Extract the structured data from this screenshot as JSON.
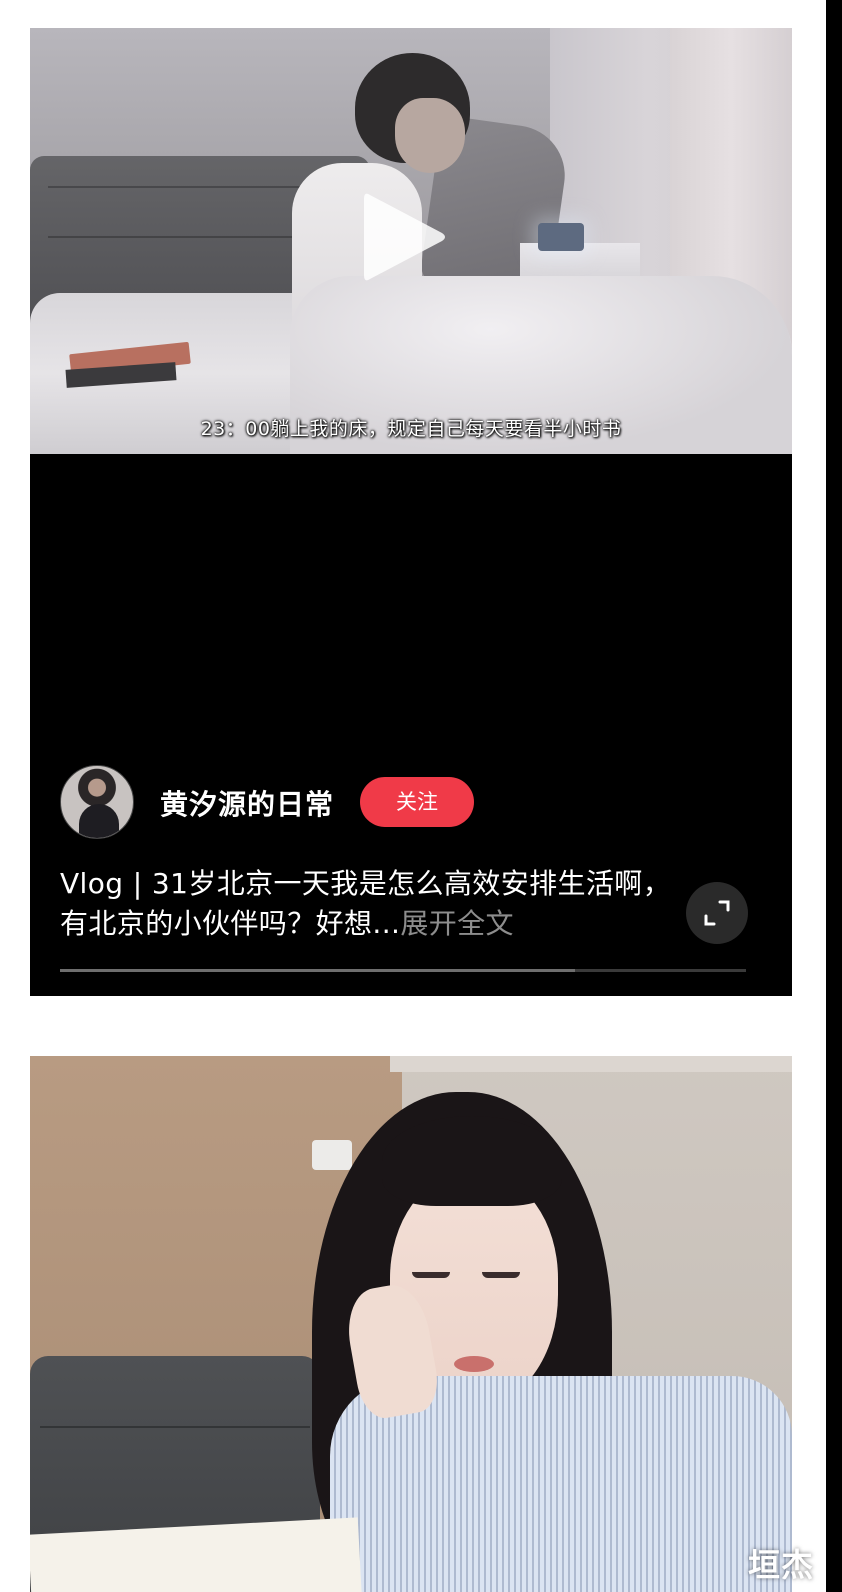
{
  "video_post": {
    "subtitle": "23：00躺上我的床，规定自己每天要看半小时书",
    "author": {
      "name": "黄汐源的日常",
      "follow_label": "关注"
    },
    "description": "Vlog | 31岁北京一天我是怎么高效安排生活啊，有北京的小伙伴吗？好想...",
    "expand_label": "展开全文",
    "progress_fraction": 0.75,
    "colors": {
      "follow_button": "#f03a48",
      "card_background": "#000000",
      "expand_text": "#8d8d8d"
    },
    "icons": [
      "play-icon",
      "fullscreen-icon"
    ]
  },
  "watermark": "垣杰"
}
